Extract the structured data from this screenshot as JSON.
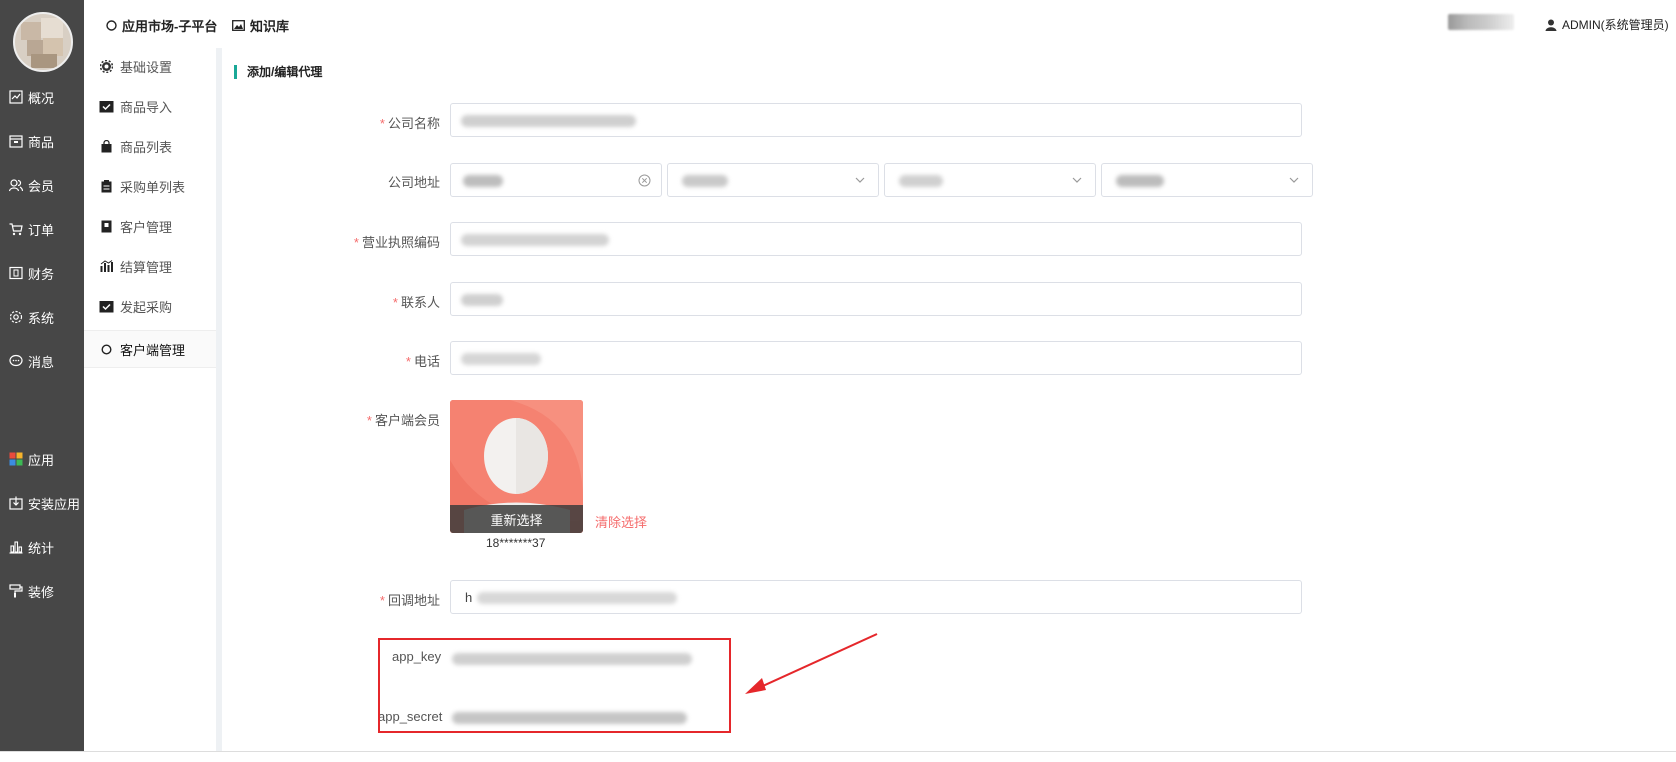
{
  "topbar": {
    "link1": "应用市场-子平台",
    "link2": "知识库",
    "admin": "ADMIN(系统管理员)"
  },
  "main_nav": [
    {
      "label": "概况",
      "icon": "chart-line-icon"
    },
    {
      "label": "商品",
      "icon": "box-icon"
    },
    {
      "label": "会员",
      "icon": "users-icon"
    },
    {
      "label": "订单",
      "icon": "cart-icon"
    },
    {
      "label": "财务",
      "icon": "wallet-icon"
    },
    {
      "label": "系统",
      "icon": "gear-icon"
    },
    {
      "label": "消息",
      "icon": "chat-icon"
    },
    {
      "label": "应用",
      "icon": "grid-icon"
    },
    {
      "label": "安装应用",
      "icon": "install-icon"
    },
    {
      "label": "统计",
      "icon": "bar-chart-icon"
    },
    {
      "label": "装修",
      "icon": "paint-roller-icon"
    }
  ],
  "sub_nav": [
    {
      "label": "基础设置",
      "icon": "gear-icon"
    },
    {
      "label": "商品导入",
      "icon": "folder-check-icon"
    },
    {
      "label": "商品列表",
      "icon": "bag-icon"
    },
    {
      "label": "采购单列表",
      "icon": "clipboard-icon"
    },
    {
      "label": "客户管理",
      "icon": "book-icon"
    },
    {
      "label": "结算管理",
      "icon": "stats-icon"
    },
    {
      "label": "发起采购",
      "icon": "folder-check-icon"
    },
    {
      "label": "客户端管理",
      "icon": "circle-icon"
    }
  ],
  "form": {
    "title": "添加/编辑代理",
    "company_name_label": "公司名称",
    "company_address_label": "公司地址",
    "license_label": "营业执照编码",
    "contact_label": "联系人",
    "phone_label": "电话",
    "member_label": "客户端会员",
    "reselect": "重新选择",
    "clear": "清除选择",
    "member_phone": "18*******37",
    "callback_label": "回调地址",
    "callback_prefix": "h",
    "app_key_label": "app_key",
    "app_secret_label": "app_secret"
  },
  "colors": {
    "sidebar": "#474747",
    "accent": "#1aa897",
    "required": "#f56c6c",
    "highlight": "#e5272b",
    "avatar_bg": "#f58271"
  }
}
